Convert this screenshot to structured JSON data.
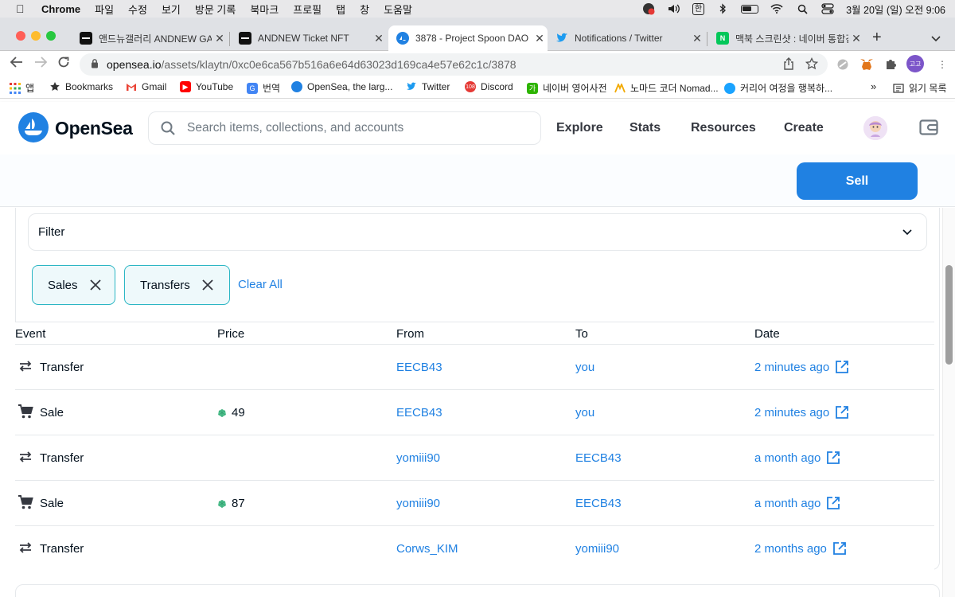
{
  "menubar": {
    "app": "Chrome",
    "items": [
      "파일",
      "수정",
      "보기",
      "방문 기록",
      "북마크",
      "프로필",
      "탭",
      "창",
      "도움말"
    ],
    "ime": "한",
    "clock": "3월 20일 (일) 오전 9:06"
  },
  "tabs": [
    {
      "title": "앤드뉴갤러리 ANDNEW GALLERY",
      "active": false
    },
    {
      "title": "ANDNEW Ticket NFT",
      "active": false
    },
    {
      "title": "3878 - Project Spoon DAO",
      "active": true
    },
    {
      "title": "Notifications / Twitter",
      "active": false
    },
    {
      "title": "맥북 스크린샷 : 네이버 통합검색",
      "active": false
    }
  ],
  "address": {
    "host": "opensea.io",
    "path": "/assets/klaytn/0xc0e6ca567b516a6e64d63023d169ca4e57e62c1c/3878"
  },
  "profile_label": "고고",
  "bookmarks": [
    {
      "label": "앱",
      "icon": "apps-grid-icon"
    },
    {
      "label": "Bookmarks",
      "icon": "star-icon"
    },
    {
      "label": "Gmail",
      "icon": "gmail-icon"
    },
    {
      "label": "YouTube",
      "icon": "youtube-icon"
    },
    {
      "label": "번역",
      "icon": "translate-icon"
    },
    {
      "label": "OpenSea, the larg...",
      "icon": "opensea-icon"
    },
    {
      "label": "Twitter",
      "icon": "twitter-icon"
    },
    {
      "label": "Discord",
      "icon": "discord-icon"
    },
    {
      "label": "네이버 영어사전",
      "icon": "naver-dict-icon"
    },
    {
      "label": "노마드 코더 Nomad...",
      "icon": "nomad-icon"
    },
    {
      "label": "커리어 여정을 행복하...",
      "icon": "career-icon"
    },
    {
      "label": "읽기 목록",
      "icon": "reading-list-icon"
    }
  ],
  "header": {
    "brand": "OpenSea",
    "search_placeholder": "Search items, collections, and accounts",
    "nav": [
      "Explore",
      "Stats",
      "Resources",
      "Create"
    ]
  },
  "sell_label": "Sell",
  "filter": {
    "label": "Filter",
    "chips": [
      "Sales",
      "Transfers"
    ],
    "clear_all": "Clear All"
  },
  "table": {
    "columns": [
      "Event",
      "Price",
      "From",
      "To",
      "Date"
    ],
    "rows": [
      {
        "event": "Transfer",
        "icon": "transfer-arrows-icon",
        "price": "",
        "from": "EECB43",
        "to": "you",
        "date": "2 minutes ago"
      },
      {
        "event": "Sale",
        "icon": "cart-icon",
        "price": "49",
        "from": "EECB43",
        "to": "you",
        "date": "2 minutes ago"
      },
      {
        "event": "Transfer",
        "icon": "transfer-arrows-icon",
        "price": "",
        "from": "yomiii90",
        "to": "EECB43",
        "date": "a month ago"
      },
      {
        "event": "Sale",
        "icon": "cart-icon",
        "price": "87",
        "from": "yomiii90",
        "to": "EECB43",
        "date": "a month ago"
      },
      {
        "event": "Transfer",
        "icon": "transfer-arrows-icon",
        "price": "",
        "from": "Corws_KIM",
        "to": "yomiii90",
        "date": "2 months ago"
      }
    ]
  },
  "colors": {
    "accent": "#2081e2",
    "chip_border": "#2bb6c4",
    "chip_bg": "#eef9fb",
    "klay": "#4fc08d"
  }
}
